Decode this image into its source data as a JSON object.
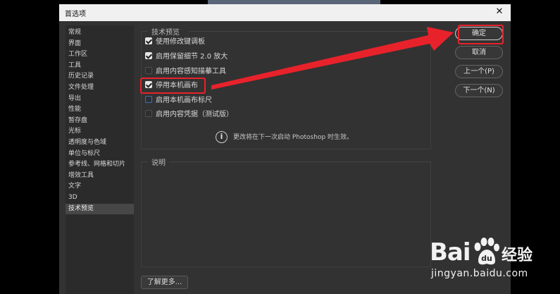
{
  "window": {
    "title": "首选项",
    "close_label": "✕"
  },
  "sidebar": {
    "items": [
      {
        "label": "常规"
      },
      {
        "label": "界面"
      },
      {
        "label": "工作区"
      },
      {
        "label": "工具"
      },
      {
        "label": "历史记录"
      },
      {
        "label": "文件处理"
      },
      {
        "label": "导出"
      },
      {
        "label": "性能"
      },
      {
        "label": "暂存盘"
      },
      {
        "label": "光标"
      },
      {
        "label": "透明度与色域"
      },
      {
        "label": "单位与标尺"
      },
      {
        "label": "参考线、网格和切片"
      },
      {
        "label": "增效工具"
      },
      {
        "label": "文字"
      },
      {
        "label": "3D"
      },
      {
        "label": "技术预览"
      }
    ],
    "selected": "技术预览"
  },
  "tech_preview": {
    "legend": "技术预览",
    "options": [
      {
        "label": "使用修改键调板",
        "checked": true
      },
      {
        "label": "启用保留细节 2.0 放大",
        "checked": true
      },
      {
        "label": "启用内容感知描摹工具",
        "checked": false
      },
      {
        "label": "停用本机画布",
        "checked": true
      },
      {
        "label": "启用本机画布标尺",
        "checked": false
      },
      {
        "label": "启用内容凭据（测试版）",
        "checked": false
      }
    ],
    "info_text": "更改将在下一次启动 Photoshop 时生效。",
    "info_icon": "info-icon"
  },
  "description": {
    "legend": "说明"
  },
  "learn_more": "了解更多...",
  "buttons": {
    "ok": "确定",
    "cancel": "取消",
    "prev": "上一个(P)",
    "next": "下一个(N)"
  },
  "watermark": {
    "brand": "Bai",
    "brand_cn": "经验",
    "url": "jingyan.baidu.com"
  },
  "annotation_color": "#e8222b"
}
